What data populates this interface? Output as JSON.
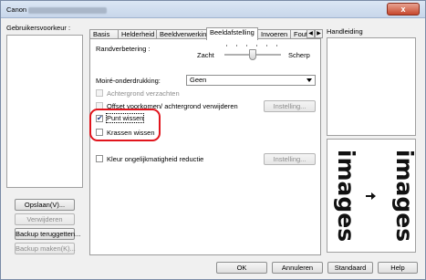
{
  "window": {
    "title_prefix": "Canon",
    "title_suffix": "",
    "close_label": "x"
  },
  "left": {
    "preferences_label": "Gebruikersvoorkeur :",
    "save_button": "Opslaan(V)...",
    "delete_button": "Verwijderen",
    "backup_restore_button": "Backup teruggetten...",
    "backup_create_button": "Backup maken(K)..."
  },
  "tabs": [
    {
      "label": "Basis"
    },
    {
      "label": "Helderheid"
    },
    {
      "label": "Beeldverwerking"
    },
    {
      "label": "Beeldafstelling"
    },
    {
      "label": "Invoeren"
    },
    {
      "label": "Foutde"
    }
  ],
  "active_tab": "Beeldafstelling",
  "panel": {
    "edge_label": "Randverbetering :",
    "edge_min": "Zacht",
    "edge_max": "Scherp",
    "edge_level_pct": 50,
    "moire_label": "Moiré-onderdrukking:",
    "moire_value": "Geen",
    "background_smooth_label": "Achtergrond verzachten",
    "offset_label": "Offset voorkomen/ achtergrond verwijderen",
    "offset_button": "Instelling...",
    "dot_remove_label": "Punt wissen",
    "dot_remove_checked": true,
    "scratch_remove_label": "Krassen wissen",
    "scratch_remove_checked": false,
    "color_unevenness_label": "Kleur ongelijkmatigheid reductie",
    "color_button": "Instelling..."
  },
  "guide": {
    "label": "Handleiding",
    "preview_word_left": "images",
    "preview_word_right": "images"
  },
  "footer": {
    "ok": "OK",
    "cancel": "Annuleren",
    "default": "Standaard",
    "help": "Help"
  },
  "colors": {
    "highlight_ring": "#e1151d",
    "title_bar": "#c7d6ea",
    "close_button": "#c7472d"
  }
}
